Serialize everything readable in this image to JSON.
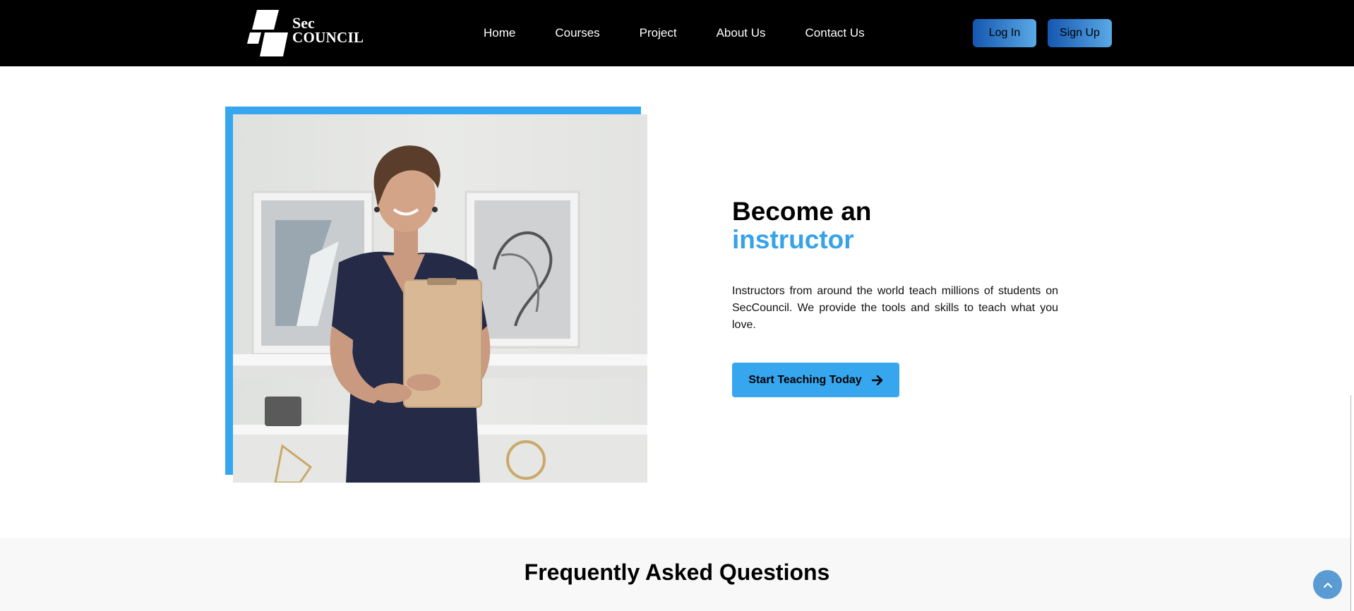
{
  "brand": {
    "line1": "Sec",
    "line2": "COUNCIL"
  },
  "nav": {
    "links": [
      "Home",
      "Courses",
      "Project",
      "About Us",
      "Contact Us"
    ],
    "login_label": "Log In",
    "signup_label": "Sign Up"
  },
  "hero": {
    "heading_line1": "Become an",
    "heading_line2": "instructor",
    "description": "Instructors from around the world teach millions of students on SecCouncil. We provide the tools and skills to teach what you love.",
    "cta_label": "Start Teaching Today",
    "cta_icon": "arrow-right-icon"
  },
  "faq": {
    "title": "Frequently Asked Questions"
  },
  "scroll_top_icon": "chevron-up-icon",
  "colors": {
    "accent": "#36a6ef",
    "navbar": "#000000",
    "button_gradient_start": "#1557b0",
    "button_gradient_end": "#5aa9e6",
    "faq_background": "#f8f8f8"
  }
}
